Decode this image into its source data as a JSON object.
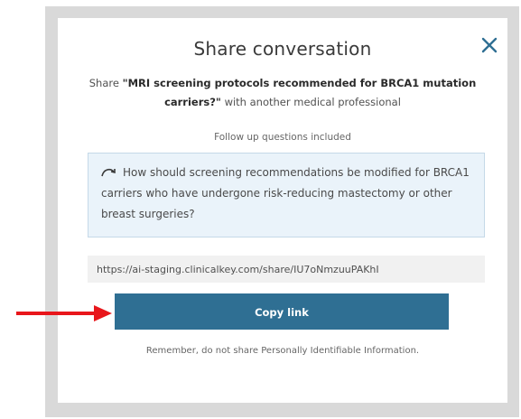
{
  "dialog": {
    "title": "Share conversation",
    "close_icon": "close-icon",
    "share_prefix": "Share",
    "conversation_title": "\"MRI screening protocols recommended for BRCA1 mutation carriers?\"",
    "share_suffix": "with another medical professional",
    "followup_label": "Follow up questions included",
    "followup_icon": "reply-arrow-icon",
    "followup_question": "How should screening recommendations be modified for BRCA1 carriers who have undergone risk-reducing mastectomy or other breast surgeries?",
    "share_link": "https://ai-staging.clinicalkey.com/share/IU7oNmzuuPAKhI",
    "copy_button_label": "Copy link",
    "reminder": "Remember, do not share Personally Identifiable Information."
  },
  "annotation": {
    "arrow_icon": "red-arrow-icon",
    "arrow_color": "#e8161b"
  },
  "colors": {
    "button": "#2f6f93",
    "question_bg": "#eaf3fa",
    "close": "#2f6f93"
  }
}
